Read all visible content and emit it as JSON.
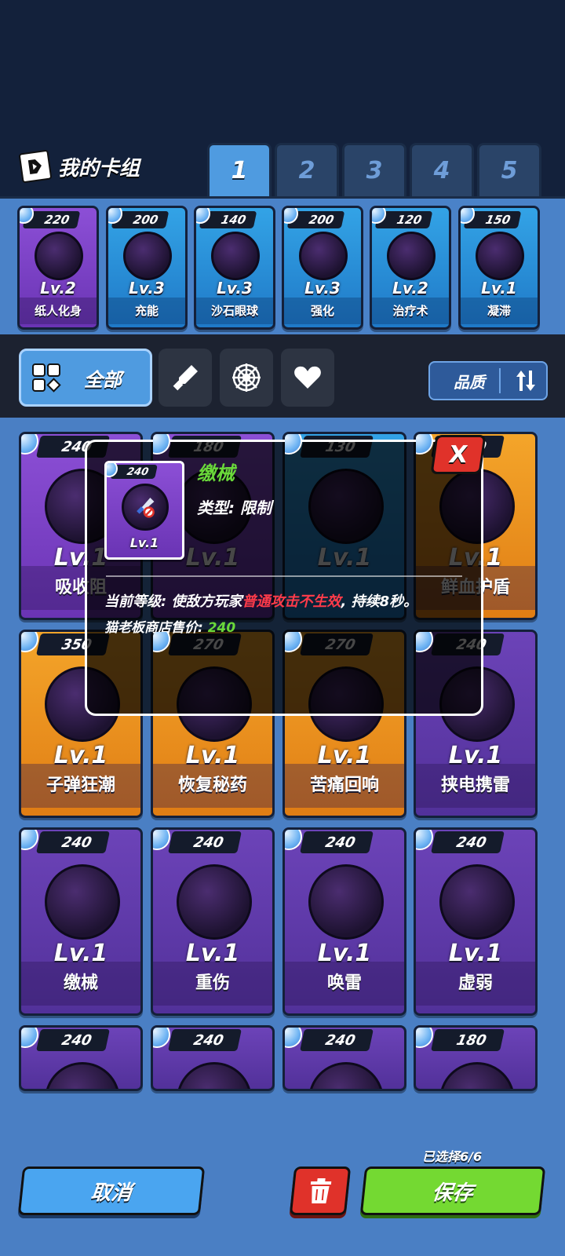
{
  "header": {
    "title": "我的卡组",
    "deck_tabs": [
      "1",
      "2",
      "3",
      "4",
      "5"
    ],
    "active_tab": "1"
  },
  "deck": [
    {
      "cost": "220",
      "level": "Lv.2",
      "name": "纸人化身",
      "color": "purple"
    },
    {
      "cost": "200",
      "level": "Lv.3",
      "name": "充能",
      "color": "blue"
    },
    {
      "cost": "140",
      "level": "Lv.3",
      "name": "沙石眼球",
      "color": "blue"
    },
    {
      "cost": "200",
      "level": "Lv.3",
      "name": "强化",
      "color": "blue"
    },
    {
      "cost": "120",
      "level": "Lv.2",
      "name": "治疗术",
      "color": "blue"
    },
    {
      "cost": "150",
      "level": "Lv.1",
      "name": "凝滞",
      "color": "blue"
    }
  ],
  "filters": {
    "all_label": "全部",
    "quality_label": "品质"
  },
  "collection": [
    {
      "cost": "240",
      "level": "Lv.1",
      "name": "吸收阻",
      "color": "purple"
    },
    {
      "cost": "180",
      "level": "Lv.1",
      "name": "",
      "color": "purple"
    },
    {
      "cost": "130",
      "level": "Lv.1",
      "name": "",
      "color": "blue"
    },
    {
      "cost": "240",
      "level": "Lv.1",
      "name": "鲜血护盾",
      "color": "orange"
    },
    {
      "cost": "350",
      "level": "Lv.1",
      "name": "子弹狂潮",
      "color": "orange"
    },
    {
      "cost": "270",
      "level": "Lv.1",
      "name": "恢复秘药",
      "color": "orange"
    },
    {
      "cost": "270",
      "level": "Lv.1",
      "name": "苦痛回响",
      "color": "orange"
    },
    {
      "cost": "240",
      "level": "Lv.1",
      "name": "挟电携雷",
      "color": "deep"
    },
    {
      "cost": "240",
      "level": "Lv.1",
      "name": "缴械",
      "color": "deep"
    },
    {
      "cost": "240",
      "level": "Lv.1",
      "name": "重伤",
      "color": "deep"
    },
    {
      "cost": "240",
      "level": "Lv.1",
      "name": "唤雷",
      "color": "deep"
    },
    {
      "cost": "240",
      "level": "Lv.1",
      "name": "虚弱",
      "color": "deep"
    },
    {
      "cost": "240",
      "level": "",
      "name": "",
      "color": "deep"
    },
    {
      "cost": "240",
      "level": "",
      "name": "",
      "color": "deep"
    },
    {
      "cost": "240",
      "level": "",
      "name": "",
      "color": "deep"
    },
    {
      "cost": "180",
      "level": "",
      "name": "",
      "color": "deep"
    }
  ],
  "popup": {
    "cost": "240",
    "level": "Lv.1",
    "title": "缴械",
    "type": "类型: 限制",
    "desc_prefix": "当前等级: 使敌方玩家",
    "desc_highlight": "普通攻击不生效",
    "desc_suffix": ", 持续8秒。",
    "price_label": "猫老板商店售价: ",
    "price_value": "240",
    "close_label": "X"
  },
  "footer": {
    "cancel_label": "取消",
    "save_label": "保存",
    "selected_label": "已选择6/6"
  },
  "colors": {
    "purple": "#8c4fd6",
    "blue": "#33a3e6",
    "orange": "#f4a52a",
    "deep": "#6c43b8",
    "highlight": "#ff3b4a",
    "green": "#6ad93a"
  }
}
